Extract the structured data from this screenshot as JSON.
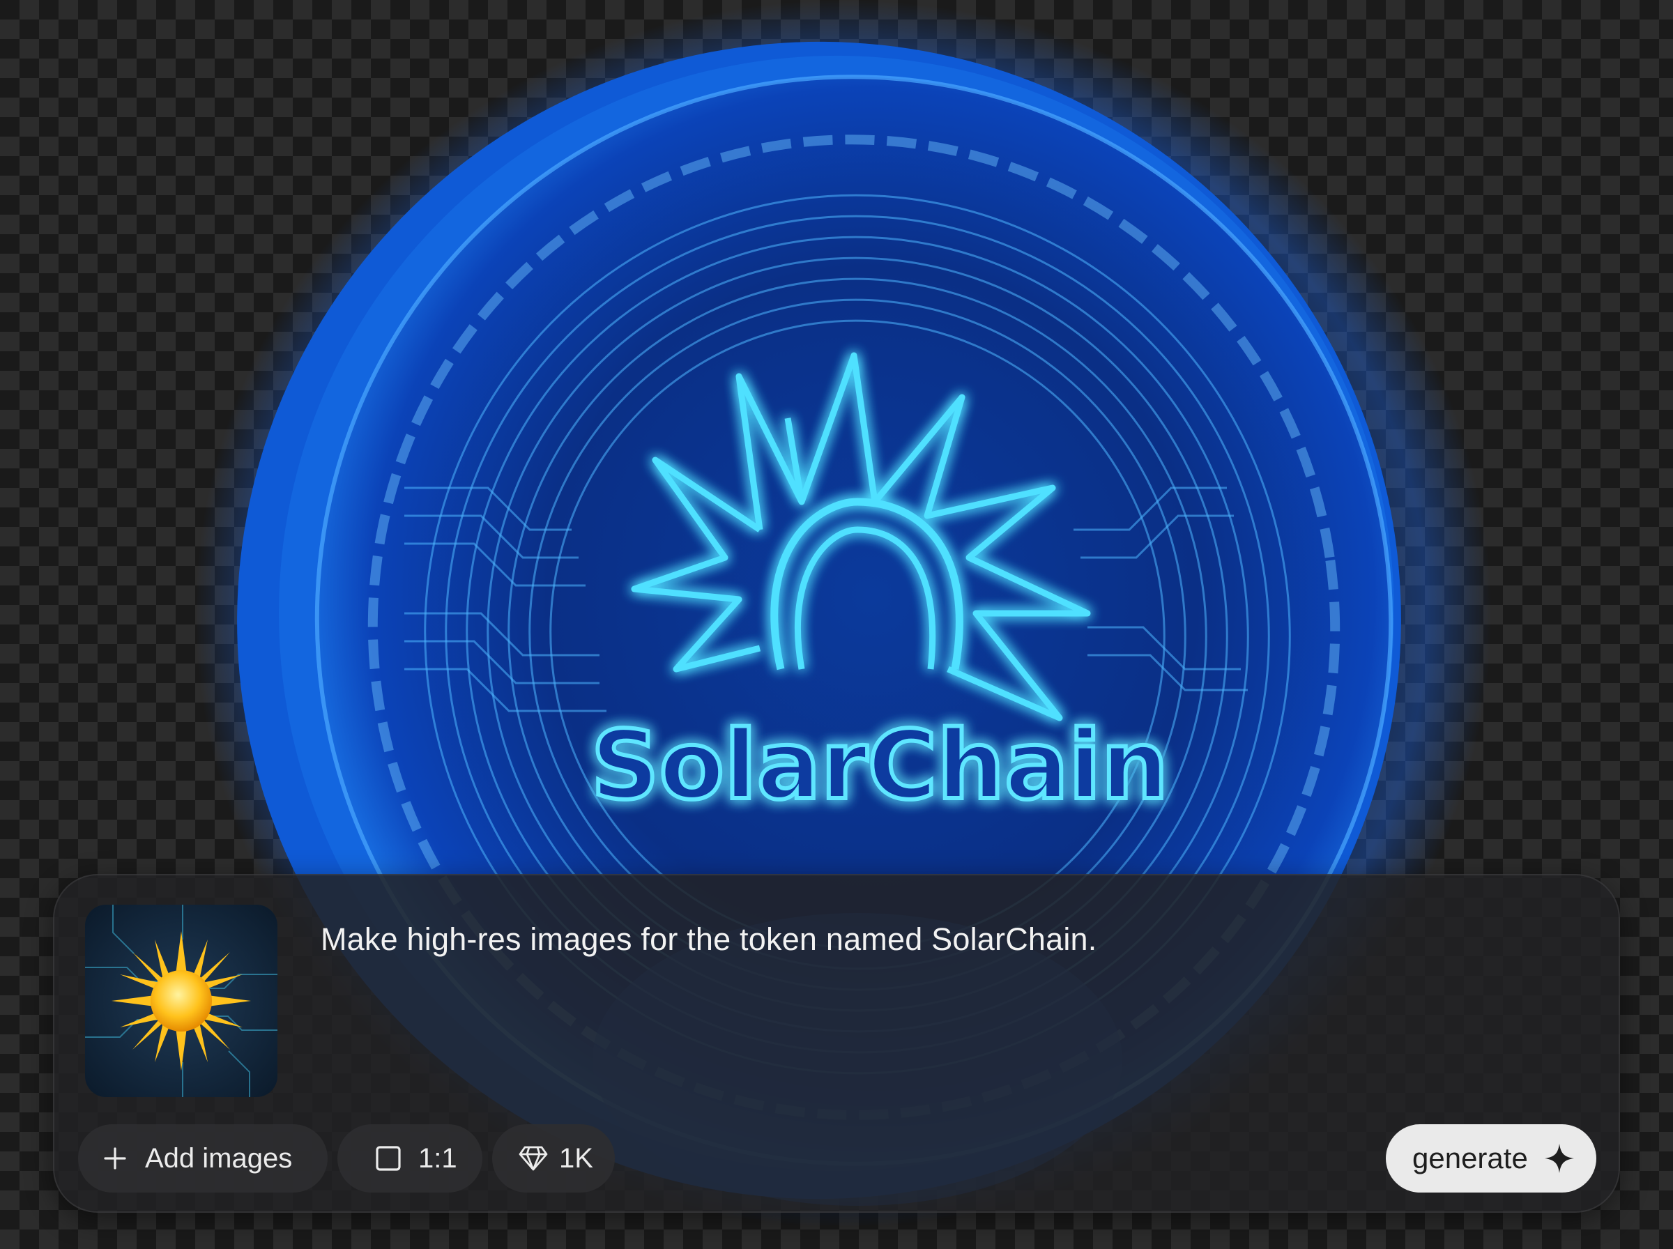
{
  "canvas": {
    "image_text": "SolarChain"
  },
  "composer": {
    "prompt": "Make high-res images for the token named SolarChain.",
    "reference_image_icon": "sun-circuit-thumbnail",
    "add_images_label": "Add images",
    "add_images_icon": "plus-icon",
    "aspect_ratio_label": "1:1",
    "aspect_ratio_icon": "square-icon",
    "quality_label": "1K",
    "quality_icon": "diamond-icon",
    "generate_label": "generate",
    "generate_icon": "sparkle-icon"
  },
  "colors": {
    "neon": "#3fd2ff",
    "coin_blue": "#0d4fc4",
    "panel": "#222224",
    "generate_bg": "#eaeaea"
  }
}
